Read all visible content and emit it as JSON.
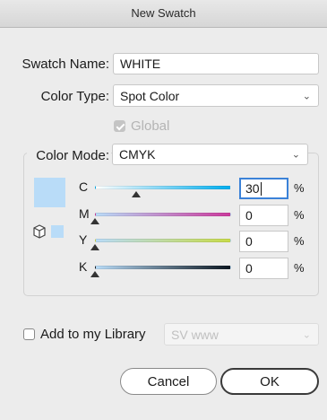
{
  "window": {
    "title": "New Swatch"
  },
  "swatch_name": {
    "label": "Swatch Name:",
    "value": "WHITE"
  },
  "color_type": {
    "label": "Color Type:",
    "value": "Spot Color"
  },
  "global": {
    "label": "Global",
    "checked": true,
    "disabled": true
  },
  "color_mode": {
    "label": "Color Mode:",
    "value": "CMYK"
  },
  "preview": {
    "color": "#b9dcf8",
    "chip_color": "#b9dcf8"
  },
  "channels": [
    {
      "letter": "C",
      "value": "30",
      "unit": "%",
      "fraction": 0.3,
      "focused": true,
      "gradient": "linear-gradient(to right, #ffffff, #00aeef)"
    },
    {
      "letter": "M",
      "value": "0",
      "unit": "%",
      "fraction": 0.0,
      "focused": false,
      "gradient": "linear-gradient(to right, #b9dcf8, #cc3a9d)"
    },
    {
      "letter": "Y",
      "value": "0",
      "unit": "%",
      "fraction": 0.0,
      "focused": false,
      "gradient": "linear-gradient(to right, #b9dcf8, #c8dc4a)"
    },
    {
      "letter": "K",
      "value": "0",
      "unit": "%",
      "fraction": 0.0,
      "focused": false,
      "gradient": "linear-gradient(to right, #b9dcf8, #0b1620)"
    }
  ],
  "library": {
    "label": "Add to my Library",
    "checked": false,
    "select_value": "SV www"
  },
  "buttons": {
    "cancel": "Cancel",
    "ok": "OK"
  },
  "icons": {
    "gamut": "cube-icon",
    "dropdown": "chevron-down-icon"
  }
}
